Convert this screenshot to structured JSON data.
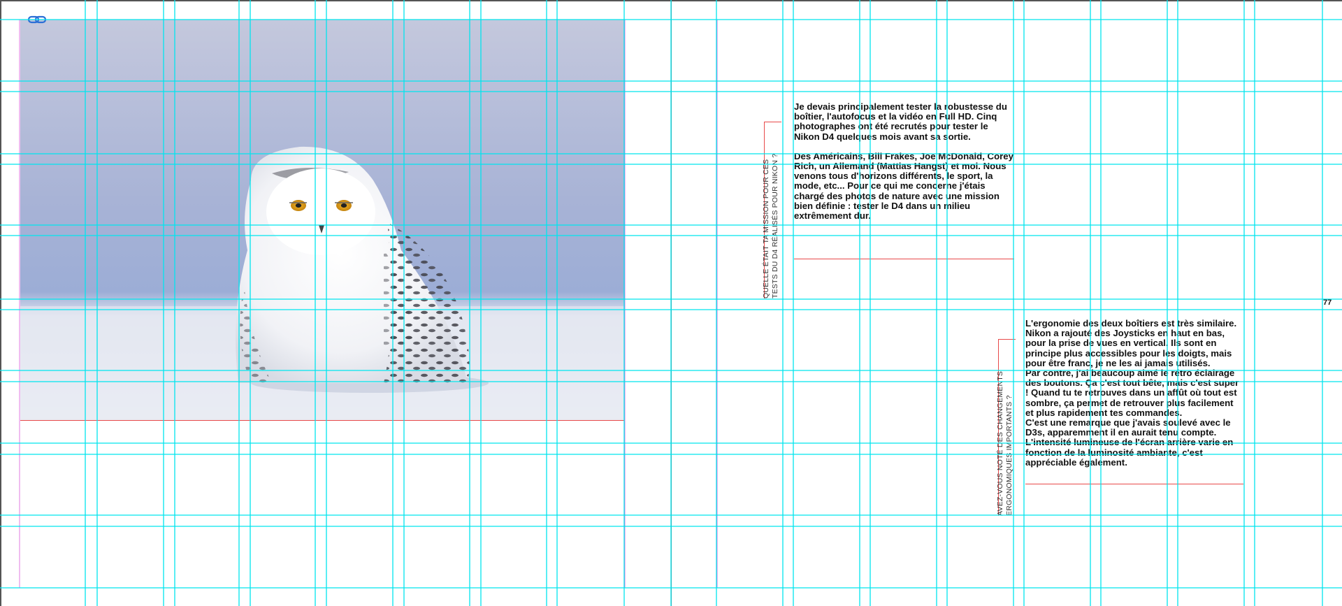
{
  "spread": {
    "page_number": "77"
  },
  "photo": {
    "subject": "snowy-owl"
  },
  "questions": [
    {
      "line1": "QUELLE ÉTAIT TA MISSION POUR CES",
      "line2": "TESTS DU D4 RÉALISÉS POUR NIKON ?"
    },
    {
      "line1": "AVEZ-VOUS NOTÉ DES CHANGEMENTS",
      "line2": "ERGONOMIQUES IMPORTANTS ?"
    }
  ],
  "answers": [
    {
      "paragraphs": [
        "Je devais principalement tester la robustesse du boîtier, l'autofocus et la vidéo en Full HD. Cinq photographes ont été recrutés pour tester le Nikon D4 quelques mois avant sa sortie.",
        "Des Américains, Bill Frakes, Joe McDonald, Corey Rich, un Allemand (Mattias Hangst) et moi. Nous venons tous d'horizons différents, le sport, la mode, etc... Pour ce qui me concerne j'étais chargé des photos de nature avec une mission bien définie : tester le D4 dans un milieu extrêmement dur."
      ]
    },
    {
      "paragraphs": [
        "L'ergonomie des deux boîtiers est très similaire. Nikon a rajouté des Joysticks en haut en bas, pour la prise de vues en vertical. Ils sont en principe plus accessibles pour les doigts, mais pour être franc, je ne les ai jamais utilisés.",
        "Par contre, j'ai beaucoup aimé le rétro éclairage des boutons. Ça c'est tout bête, mais c'est super ! Quand tu te retrouves dans un affût où tout est sombre, ça permet de retrouver plus facilement et plus rapidement tes commandes.",
        "C'est une remarque que j'avais soulevé avec le D3s, apparemment il en aurait tenu compte. L'intensité lumineuse de l'écran arrière varie en fonction de la luminosité ambiante, c'est appréciable également."
      ]
    }
  ],
  "colors": {
    "guide_cyan": "#00e5ee",
    "margin_magenta": "#e07be0",
    "frame_red": "#e8494a",
    "link_badge_blue": "#2b6fd6"
  },
  "icons": {
    "link_badge": "chain-link-icon"
  }
}
